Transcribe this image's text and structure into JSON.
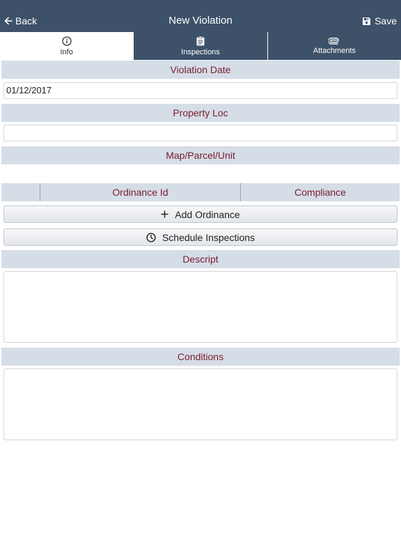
{
  "nav": {
    "back_label": "Back",
    "title": "New Violation",
    "save_label": "Save",
    "background": "#3d5169"
  },
  "tabs": [
    {
      "label": "Info",
      "icon": "info-circle-icon",
      "active": true
    },
    {
      "label": "Inspections",
      "icon": "clipboard-icon",
      "active": false
    },
    {
      "label": "Attachments",
      "icon": "paperclip-icon",
      "active": false
    }
  ],
  "form": {
    "violation_date": {
      "label": "Violation Date",
      "value": "01/12/2017"
    },
    "property_loc": {
      "label": "Property Loc",
      "value": ""
    },
    "map_parcel_unit": {
      "label": "Map/Parcel/Unit",
      "value": ""
    },
    "ordinance_table": {
      "columns": [
        "",
        "Ordinance Id",
        "Compliance"
      ]
    },
    "add_ordinance_label": "Add Ordinance",
    "schedule_inspections_label": "Schedule Inspections",
    "descript": {
      "label": "Descript",
      "value": ""
    },
    "conditions": {
      "label": "Conditions",
      "value": ""
    }
  },
  "colors": {
    "header_bg": "#d5dde7",
    "header_text": "#7a1c2e"
  }
}
